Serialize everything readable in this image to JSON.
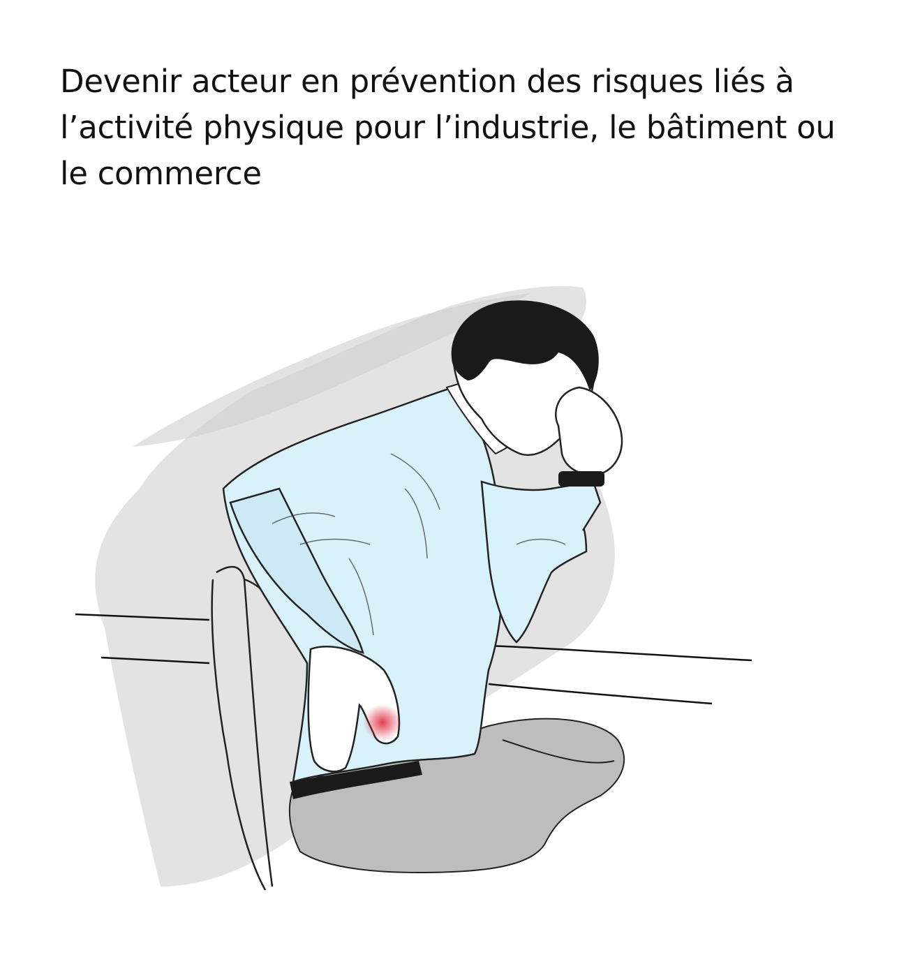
{
  "header": {
    "title_lines": [
      "Devenir acteur en prévention des risques liés à",
      "l’activité physique pour l’industrie, le bâtiment ou",
      "le commerce"
    ]
  },
  "illustration": {
    "icon": "seated-man-back-pain-sketch-icon",
    "colors": {
      "shirt": "#d9f1fb",
      "shadow": "#d6d6d6",
      "trousers": "#bdbdbd",
      "hair": "#1a1a1a",
      "pain": "#e0344a",
      "ink": "#111111"
    }
  }
}
